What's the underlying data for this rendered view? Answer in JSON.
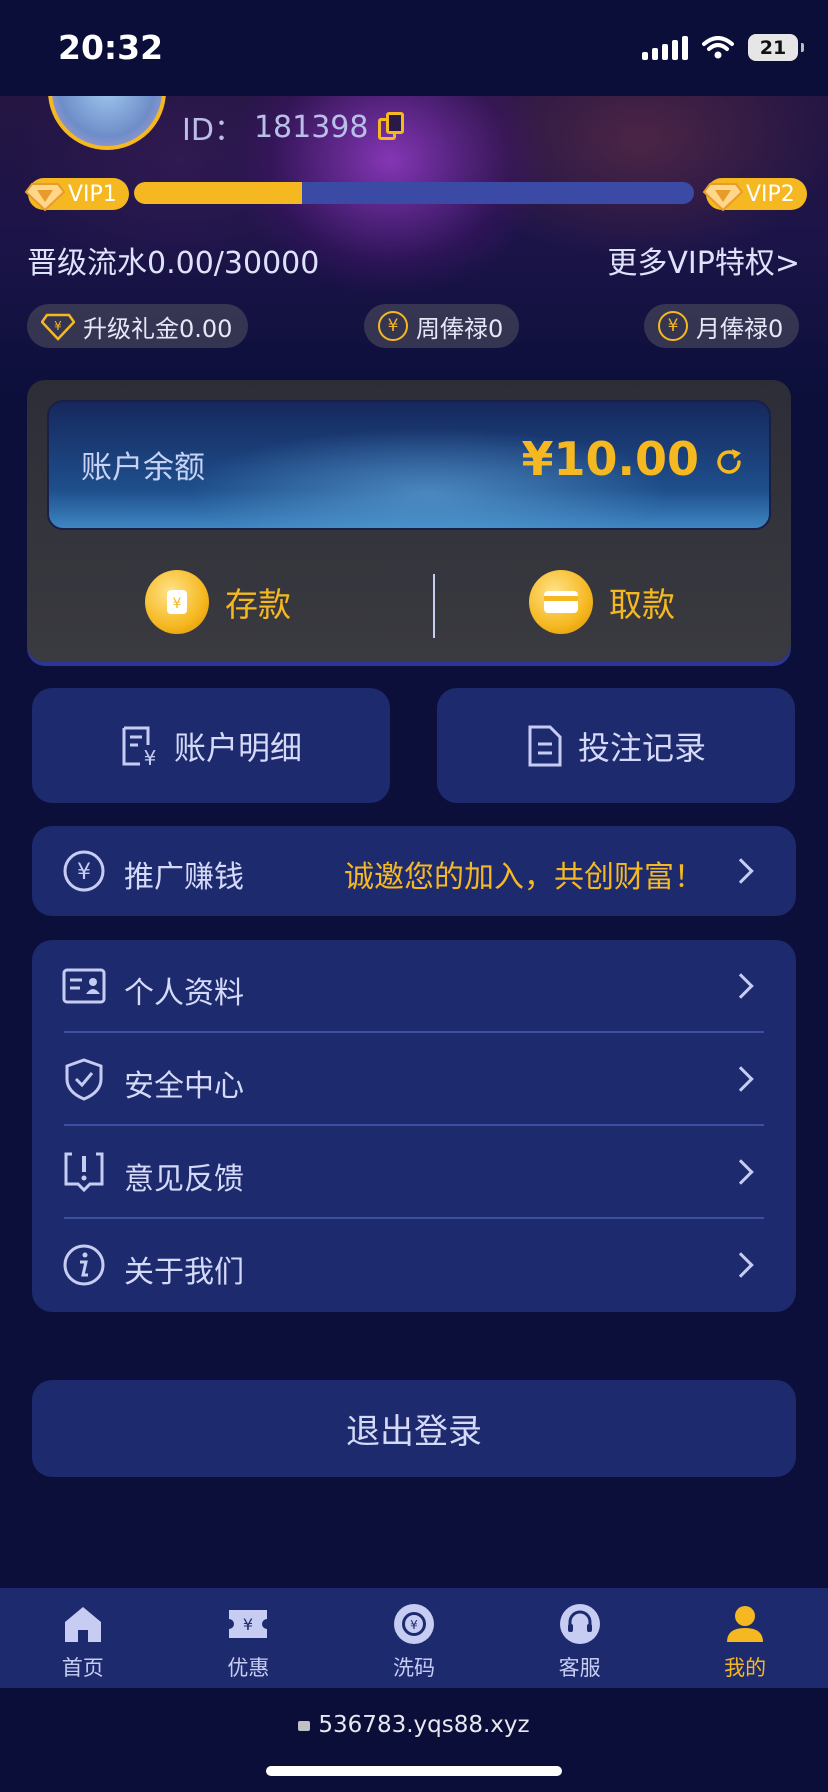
{
  "status_bar": {
    "time": "20:32",
    "battery": "21"
  },
  "profile": {
    "id_label": "ID：",
    "id_value": "181398"
  },
  "vip": {
    "current": "VIP1",
    "next": "VIP2",
    "progress_fraction": 0.3,
    "upgrade_text": "晋级流水0.00/30000",
    "more_link": "更多VIP特权>"
  },
  "rewards": [
    {
      "label": "升级礼金0.00",
      "icon": "diamond-yen-icon"
    },
    {
      "label": "周俸禄0",
      "icon": "yen-coin-icon"
    },
    {
      "label": "月俸禄0",
      "icon": "yen-coin-icon"
    }
  ],
  "wallet": {
    "balance_label": "账户余额",
    "balance_value": "¥10.00",
    "deposit_label": "存款",
    "withdraw_label": "取款"
  },
  "quick_actions": {
    "account_detail": "账户明细",
    "bet_records": "投注记录"
  },
  "promotion": {
    "label": "推广赚钱",
    "slogan": "诚邀您的加入，共创财富！"
  },
  "menu": [
    {
      "label": "个人资料",
      "icon": "id-card-icon"
    },
    {
      "label": "安全中心",
      "icon": "shield-icon"
    },
    {
      "label": "意见反馈",
      "icon": "feedback-icon"
    },
    {
      "label": "关于我们",
      "icon": "info-icon"
    }
  ],
  "logout_label": "退出登录",
  "tabs": [
    {
      "label": "首页",
      "icon": "home-icon"
    },
    {
      "label": "优惠",
      "icon": "ticket-icon"
    },
    {
      "label": "洗码",
      "icon": "chip-icon"
    },
    {
      "label": "客服",
      "icon": "headset-icon"
    },
    {
      "label": "我的",
      "icon": "user-icon",
      "active": true
    }
  ],
  "url": "536783.yqs88.xyz",
  "colors": {
    "accent": "#f5b820",
    "card": "#1e2a6e",
    "background": "#0b0f3a"
  }
}
